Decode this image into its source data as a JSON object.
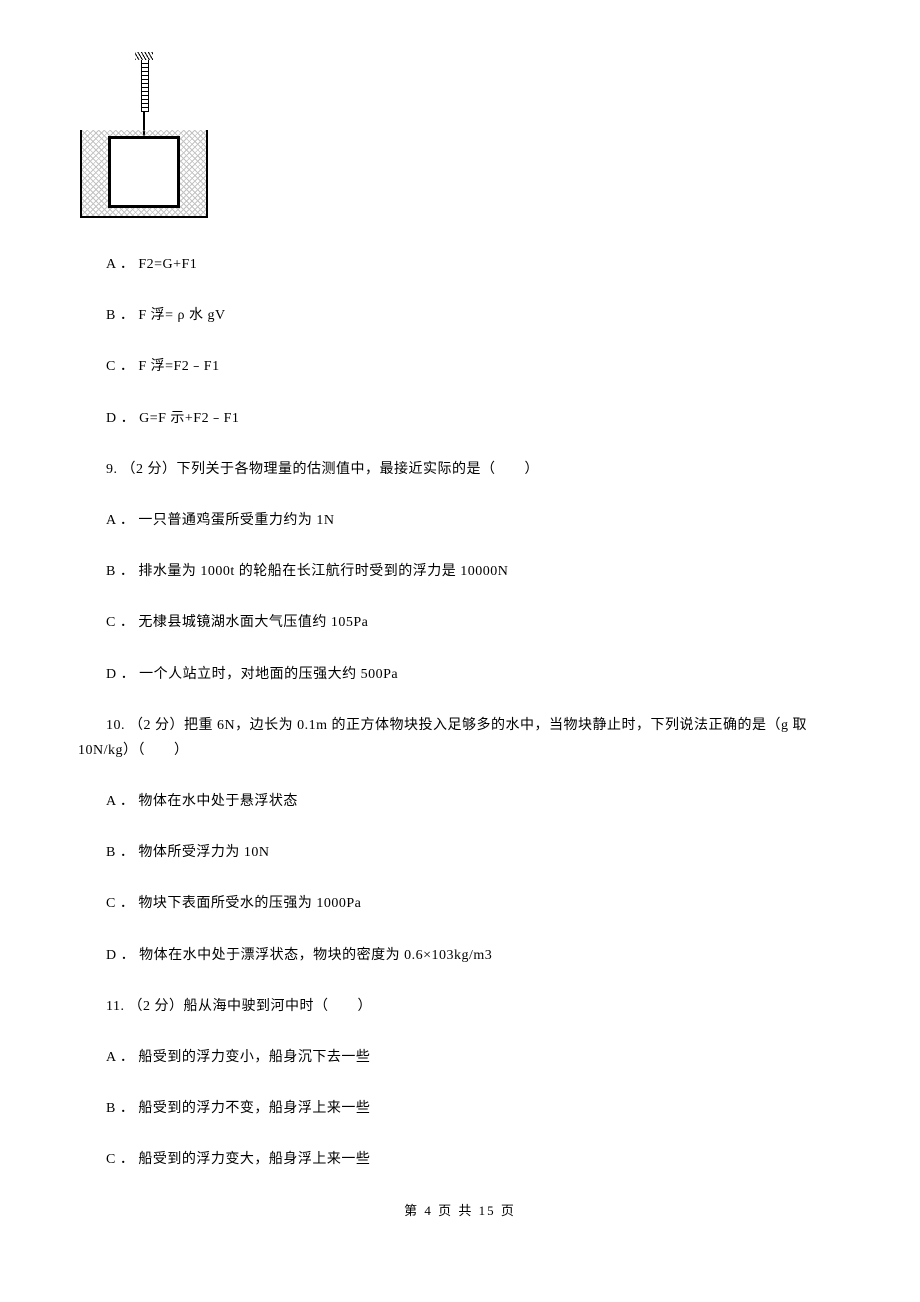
{
  "q8": {
    "optA": "A ． F2=G+F1",
    "optB": "B ． F 浮= ρ 水 gV",
    "optC": "C ． F 浮=F2﹣F1",
    "optD": "D ． G=F 示+F2﹣F1"
  },
  "q9": {
    "stem": "9. （2 分）下列关于各物理量的估测值中，最接近实际的是（　　）",
    "optA": "A ． 一只普通鸡蛋所受重力约为 1N",
    "optB": "B ． 排水量为 1000t 的轮船在长江航行时受到的浮力是 10000N",
    "optC": "C ． 无棣县城镜湖水面大气压值约 105Pa",
    "optD": "D ． 一个人站立时，对地面的压强大约 500Pa"
  },
  "q10": {
    "stem": "10. （2 分）把重 6N，边长为 0.1m 的正方体物块投入足够多的水中，当物块静止时，下列说法正确的是（g 取 10N/kg）（　　）",
    "optA": "A ． 物体在水中处于悬浮状态",
    "optB": "B ． 物体所受浮力为 10N",
    "optC": "C ． 物块下表面所受水的压强为 1000Pa",
    "optD": "D ． 物体在水中处于漂浮状态，物块的密度为 0.6×103kg/m3"
  },
  "q11": {
    "stem": "11. （2 分）船从海中驶到河中时（　　）",
    "optA": "A ． 船受到的浮力变小，船身沉下去一些",
    "optB": "B ． 船受到的浮力不变，船身浮上来一些",
    "optC": "C ． 船受到的浮力变大，船身浮上来一些"
  },
  "footer": "第 4 页 共 15 页"
}
